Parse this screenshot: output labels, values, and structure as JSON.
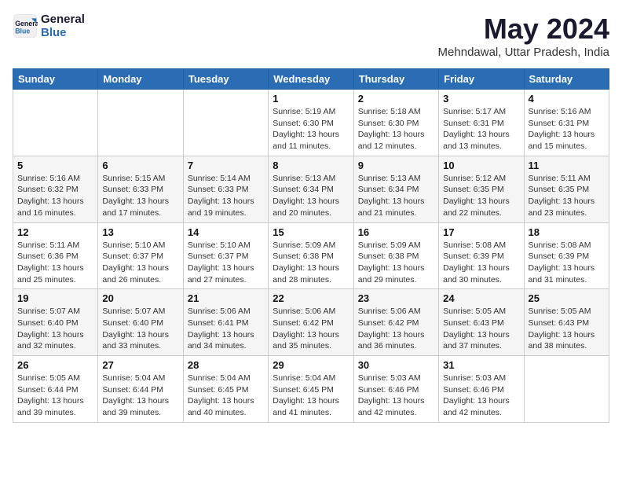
{
  "header": {
    "logo_line1": "General",
    "logo_line2": "Blue",
    "month": "May 2024",
    "location": "Mehndawal, Uttar Pradesh, India"
  },
  "weekdays": [
    "Sunday",
    "Monday",
    "Tuesday",
    "Wednesday",
    "Thursday",
    "Friday",
    "Saturday"
  ],
  "weeks": [
    [
      {
        "day": "",
        "info": ""
      },
      {
        "day": "",
        "info": ""
      },
      {
        "day": "",
        "info": ""
      },
      {
        "day": "1",
        "info": "Sunrise: 5:19 AM\nSunset: 6:30 PM\nDaylight: 13 hours\nand 11 minutes."
      },
      {
        "day": "2",
        "info": "Sunrise: 5:18 AM\nSunset: 6:30 PM\nDaylight: 13 hours\nand 12 minutes."
      },
      {
        "day": "3",
        "info": "Sunrise: 5:17 AM\nSunset: 6:31 PM\nDaylight: 13 hours\nand 13 minutes."
      },
      {
        "day": "4",
        "info": "Sunrise: 5:16 AM\nSunset: 6:31 PM\nDaylight: 13 hours\nand 15 minutes."
      }
    ],
    [
      {
        "day": "5",
        "info": "Sunrise: 5:16 AM\nSunset: 6:32 PM\nDaylight: 13 hours\nand 16 minutes."
      },
      {
        "day": "6",
        "info": "Sunrise: 5:15 AM\nSunset: 6:33 PM\nDaylight: 13 hours\nand 17 minutes."
      },
      {
        "day": "7",
        "info": "Sunrise: 5:14 AM\nSunset: 6:33 PM\nDaylight: 13 hours\nand 19 minutes."
      },
      {
        "day": "8",
        "info": "Sunrise: 5:13 AM\nSunset: 6:34 PM\nDaylight: 13 hours\nand 20 minutes."
      },
      {
        "day": "9",
        "info": "Sunrise: 5:13 AM\nSunset: 6:34 PM\nDaylight: 13 hours\nand 21 minutes."
      },
      {
        "day": "10",
        "info": "Sunrise: 5:12 AM\nSunset: 6:35 PM\nDaylight: 13 hours\nand 22 minutes."
      },
      {
        "day": "11",
        "info": "Sunrise: 5:11 AM\nSunset: 6:35 PM\nDaylight: 13 hours\nand 23 minutes."
      }
    ],
    [
      {
        "day": "12",
        "info": "Sunrise: 5:11 AM\nSunset: 6:36 PM\nDaylight: 13 hours\nand 25 minutes."
      },
      {
        "day": "13",
        "info": "Sunrise: 5:10 AM\nSunset: 6:37 PM\nDaylight: 13 hours\nand 26 minutes."
      },
      {
        "day": "14",
        "info": "Sunrise: 5:10 AM\nSunset: 6:37 PM\nDaylight: 13 hours\nand 27 minutes."
      },
      {
        "day": "15",
        "info": "Sunrise: 5:09 AM\nSunset: 6:38 PM\nDaylight: 13 hours\nand 28 minutes."
      },
      {
        "day": "16",
        "info": "Sunrise: 5:09 AM\nSunset: 6:38 PM\nDaylight: 13 hours\nand 29 minutes."
      },
      {
        "day": "17",
        "info": "Sunrise: 5:08 AM\nSunset: 6:39 PM\nDaylight: 13 hours\nand 30 minutes."
      },
      {
        "day": "18",
        "info": "Sunrise: 5:08 AM\nSunset: 6:39 PM\nDaylight: 13 hours\nand 31 minutes."
      }
    ],
    [
      {
        "day": "19",
        "info": "Sunrise: 5:07 AM\nSunset: 6:40 PM\nDaylight: 13 hours\nand 32 minutes."
      },
      {
        "day": "20",
        "info": "Sunrise: 5:07 AM\nSunset: 6:40 PM\nDaylight: 13 hours\nand 33 minutes."
      },
      {
        "day": "21",
        "info": "Sunrise: 5:06 AM\nSunset: 6:41 PM\nDaylight: 13 hours\nand 34 minutes."
      },
      {
        "day": "22",
        "info": "Sunrise: 5:06 AM\nSunset: 6:42 PM\nDaylight: 13 hours\nand 35 minutes."
      },
      {
        "day": "23",
        "info": "Sunrise: 5:06 AM\nSunset: 6:42 PM\nDaylight: 13 hours\nand 36 minutes."
      },
      {
        "day": "24",
        "info": "Sunrise: 5:05 AM\nSunset: 6:43 PM\nDaylight: 13 hours\nand 37 minutes."
      },
      {
        "day": "25",
        "info": "Sunrise: 5:05 AM\nSunset: 6:43 PM\nDaylight: 13 hours\nand 38 minutes."
      }
    ],
    [
      {
        "day": "26",
        "info": "Sunrise: 5:05 AM\nSunset: 6:44 PM\nDaylight: 13 hours\nand 39 minutes."
      },
      {
        "day": "27",
        "info": "Sunrise: 5:04 AM\nSunset: 6:44 PM\nDaylight: 13 hours\nand 39 minutes."
      },
      {
        "day": "28",
        "info": "Sunrise: 5:04 AM\nSunset: 6:45 PM\nDaylight: 13 hours\nand 40 minutes."
      },
      {
        "day": "29",
        "info": "Sunrise: 5:04 AM\nSunset: 6:45 PM\nDaylight: 13 hours\nand 41 minutes."
      },
      {
        "day": "30",
        "info": "Sunrise: 5:03 AM\nSunset: 6:46 PM\nDaylight: 13 hours\nand 42 minutes."
      },
      {
        "day": "31",
        "info": "Sunrise: 5:03 AM\nSunset: 6:46 PM\nDaylight: 13 hours\nand 42 minutes."
      },
      {
        "day": "",
        "info": ""
      }
    ]
  ]
}
